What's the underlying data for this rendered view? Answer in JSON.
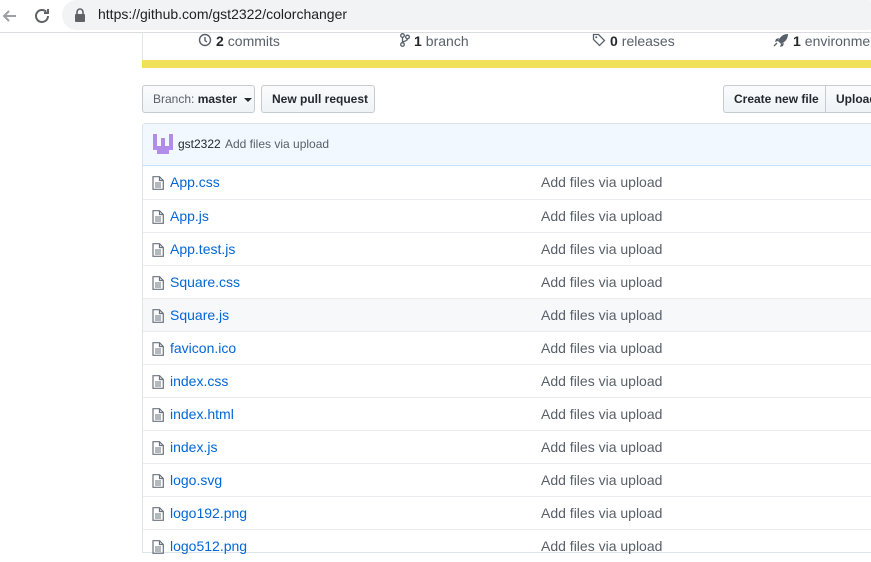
{
  "browser": {
    "url": "https://github.com/gst2322/colorchanger"
  },
  "summary": {
    "commits": {
      "count": "2",
      "label": "commits"
    },
    "branches": {
      "count": "1",
      "label": "branch"
    },
    "releases": {
      "count": "0",
      "label": "releases"
    },
    "environments": {
      "count": "1",
      "label": "environment"
    }
  },
  "language_color": "#f1e05a",
  "controls": {
    "branch_label": "Branch:",
    "branch_value": "master",
    "new_pr": "New pull request",
    "create_file": "Create new file",
    "upload": "Upload files"
  },
  "latest_commit": {
    "author": "gst2322",
    "message": "Add files via upload"
  },
  "files": [
    {
      "name": "App.css",
      "message": "Add files via upload"
    },
    {
      "name": "App.js",
      "message": "Add files via upload"
    },
    {
      "name": "App.test.js",
      "message": "Add files via upload"
    },
    {
      "name": "Square.css",
      "message": "Add files via upload"
    },
    {
      "name": "Square.js",
      "message": "Add files via upload"
    },
    {
      "name": "favicon.ico",
      "message": "Add files via upload"
    },
    {
      "name": "index.css",
      "message": "Add files via upload"
    },
    {
      "name": "index.html",
      "message": "Add files via upload"
    },
    {
      "name": "index.js",
      "message": "Add files via upload"
    },
    {
      "name": "logo.svg",
      "message": "Add files via upload"
    },
    {
      "name": "logo192.png",
      "message": "Add files via upload"
    },
    {
      "name": "logo512.png",
      "message": "Add files via upload"
    }
  ]
}
